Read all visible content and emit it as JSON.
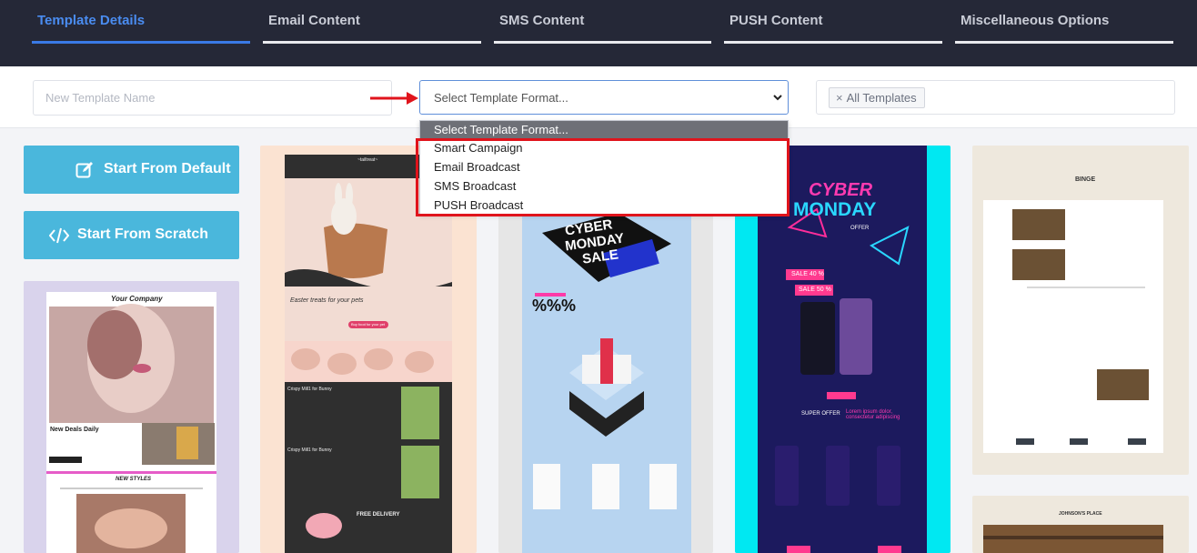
{
  "tabs": [
    {
      "label": "Template Details",
      "active": true
    },
    {
      "label": "Email Content",
      "active": false
    },
    {
      "label": "SMS Content",
      "active": false
    },
    {
      "label": "PUSH Content",
      "active": false
    },
    {
      "label": "Miscellaneous Options",
      "active": false
    }
  ],
  "filters": {
    "name_placeholder": "New Template Name",
    "format_selected": "Select Template Format...",
    "tag_label": "All Templates",
    "tag_remove_icon": "×"
  },
  "dropdown": {
    "options": [
      "Select Template Format...",
      "Smart Campaign",
      "Email Broadcast",
      "SMS Broadcast",
      "PUSH Broadcast"
    ]
  },
  "actions": {
    "start_default": "Start From Default",
    "start_scratch": "Start From Scratch"
  },
  "templates": {
    "company": {
      "brand": "Your Company",
      "section_1": "New Deals Daily",
      "section_2": "NEW STYLES"
    },
    "pets": {
      "brand": "~tailtreat~",
      "headline": "Easter treats for your pets",
      "cta": "Buy food for your pet",
      "product_1": "Crispy Mill1 for Bunny",
      "product_2": "Crispy Mill1 for Bunny",
      "delivery": "FREE DELIVERY"
    },
    "sale": {
      "headline_1": "CYBER",
      "headline_2": "MONDAY",
      "headline_3": "SALE",
      "percent": "%%%"
    },
    "cyber": {
      "brand": "pany",
      "headline_1": "CYBER",
      "headline_2": "MONDAY",
      "offer": "OFFER",
      "sale_1": "SALE 40 %",
      "sale_2": "SALE 50 %",
      "super_offer": "SUPER OFFER",
      "lorem": "Lorem ipsum dolor, consectetur adipiscing"
    },
    "binge": {
      "brand": "BINGE",
      "brand_2": "JOHNSON'S PLACE"
    }
  },
  "colors": {
    "nav_bg": "#252837",
    "active_tab": "#3a7ae6",
    "button": "#4ab7dc",
    "highlight": "#e0141c"
  }
}
